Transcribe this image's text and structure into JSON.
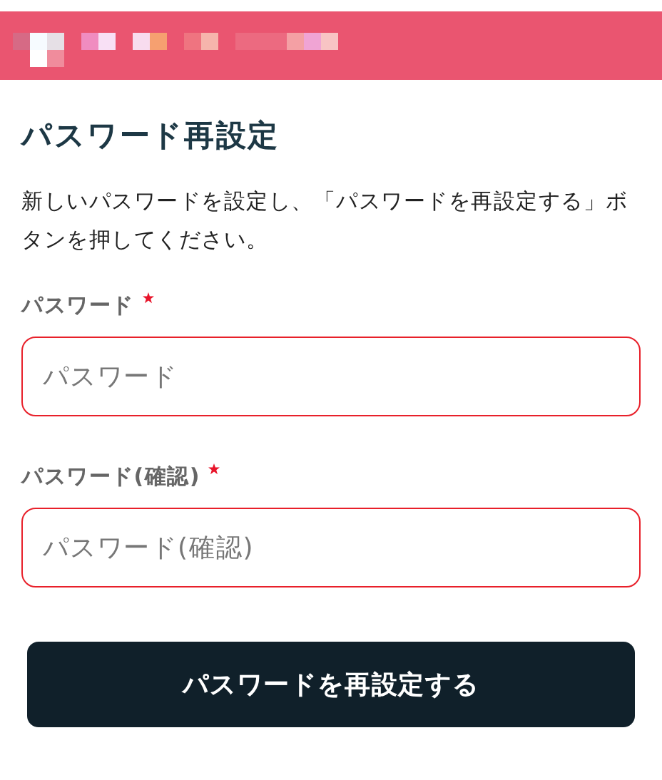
{
  "title": "パスワード再設定",
  "description": "新しいパスワードを設定し、「パスワードを再設定する」ボタンを押してください。",
  "fields": [
    {
      "label": "パスワード",
      "required": true,
      "placeholder": "パスワード",
      "error": true
    },
    {
      "label": "パスワード(確認)",
      "required": true,
      "placeholder": "パスワード(確認)",
      "error": true
    }
  ],
  "submit_button": "パスワードを再設定する"
}
